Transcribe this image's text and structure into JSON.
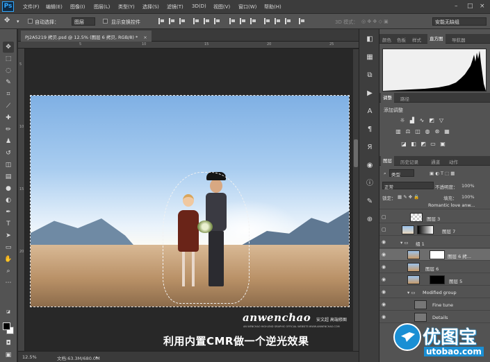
{
  "app": {
    "logo": "Ps"
  },
  "menu": [
    "文件(F)",
    "编辑(E)",
    "图像(I)",
    "图层(L)",
    "类型(Y)",
    "选择(S)",
    "滤镜(T)",
    "3D(D)",
    "视图(V)",
    "窗口(W)",
    "帮助(H)"
  ],
  "options": {
    "auto_select_label": "自动选择：",
    "auto_select_value": "图层",
    "show_transform_label": "显示变换控件",
    "mode_label": "3D 模式：",
    "workspace": "安能无缺组"
  },
  "document": {
    "tab_title": "PJ2A5219 拷贝.psd @ 12.5% (图层 6 拷贝, RGB/8) *",
    "ruler_marks": [
      "5",
      "10",
      "15",
      "20",
      "25"
    ]
  },
  "watermark": {
    "brand": "anwenchao",
    "sub": "AN WENCHAO HIGH-END GRAPHIC OFFICIAL WEBSITE:WWW.ANWENCHAO.COM",
    "right": "安文超 高端修图",
    "caption": "利用内置CMR做一个逆光效果"
  },
  "status": {
    "zoom": "12.5%",
    "doc": "文档:63.3M/680.0M"
  },
  "panels": {
    "top_tabs": [
      "颜色",
      "色板",
      "样式",
      "直方图",
      "导航器"
    ],
    "adjust_tabs": [
      "调整",
      "路径"
    ],
    "adjust_title": "添加调整",
    "layer_tabs": [
      "图层",
      "历史记录",
      "通道",
      "动作"
    ],
    "kind_label": "类型",
    "blend_mode": "正常",
    "opacity_label": "不透明度：",
    "opacity_value": "100%",
    "lock_label": "锁定：",
    "fill_label": "填充：",
    "fill_value": "100%",
    "layers": [
      {
        "name": "Romantic love  anw..."
      },
      {
        "name": "图层 3"
      },
      {
        "name": "图层 7"
      },
      {
        "name": "组 1"
      },
      {
        "name": "图层 6 拷..."
      },
      {
        "name": "图层 6"
      },
      {
        "name": "图层 5"
      },
      {
        "name": "Modified group"
      },
      {
        "name": "Fine tune"
      },
      {
        "name": "Details"
      }
    ]
  },
  "site_badge": {
    "name": "优图宝",
    "url": "utobao.com"
  },
  "colors": {
    "accent": "#31a8ff",
    "panel": "#535353",
    "dark": "#282828",
    "badge": "#1a8fd4"
  }
}
